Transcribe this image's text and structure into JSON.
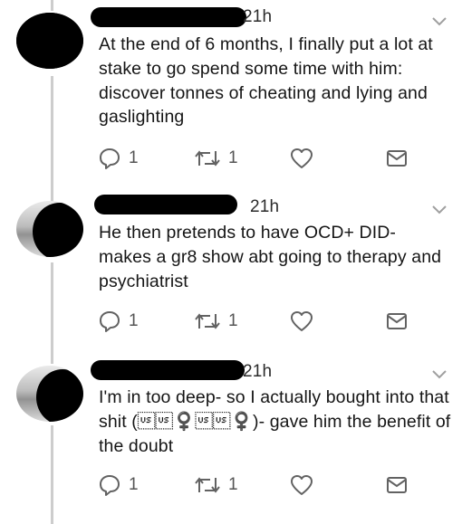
{
  "tweets": [
    {
      "time": "21h",
      "text": "At the end of 6 months, I finally put a lot at stake to go spend some time with him: discover tonnes of cheating and lying and gaslighting",
      "reply_count": "1",
      "retweet_count": "1"
    },
    {
      "time": "21h",
      "text": "He then pretends to have OCD+ DID- makes a gr8 show abt going to therapy and psychiatrist",
      "reply_count": "1",
      "retweet_count": "1"
    },
    {
      "time": "21h",
      "text": "I'm in too deep- so I actually bought into that shit (\u001f\u001f♀️\u001f\u001f♀️)- gave him the benefit of the doubt",
      "reply_count": "1",
      "retweet_count": "1"
    }
  ],
  "icons": {
    "reply": "reply-icon",
    "retweet": "retweet-icon",
    "like": "heart-icon",
    "message": "envelope-icon",
    "caret": "chevron-down-icon"
  },
  "colors": {
    "thread_line": "#c8ced3",
    "icon": "#5d6369",
    "text": "#151515"
  }
}
